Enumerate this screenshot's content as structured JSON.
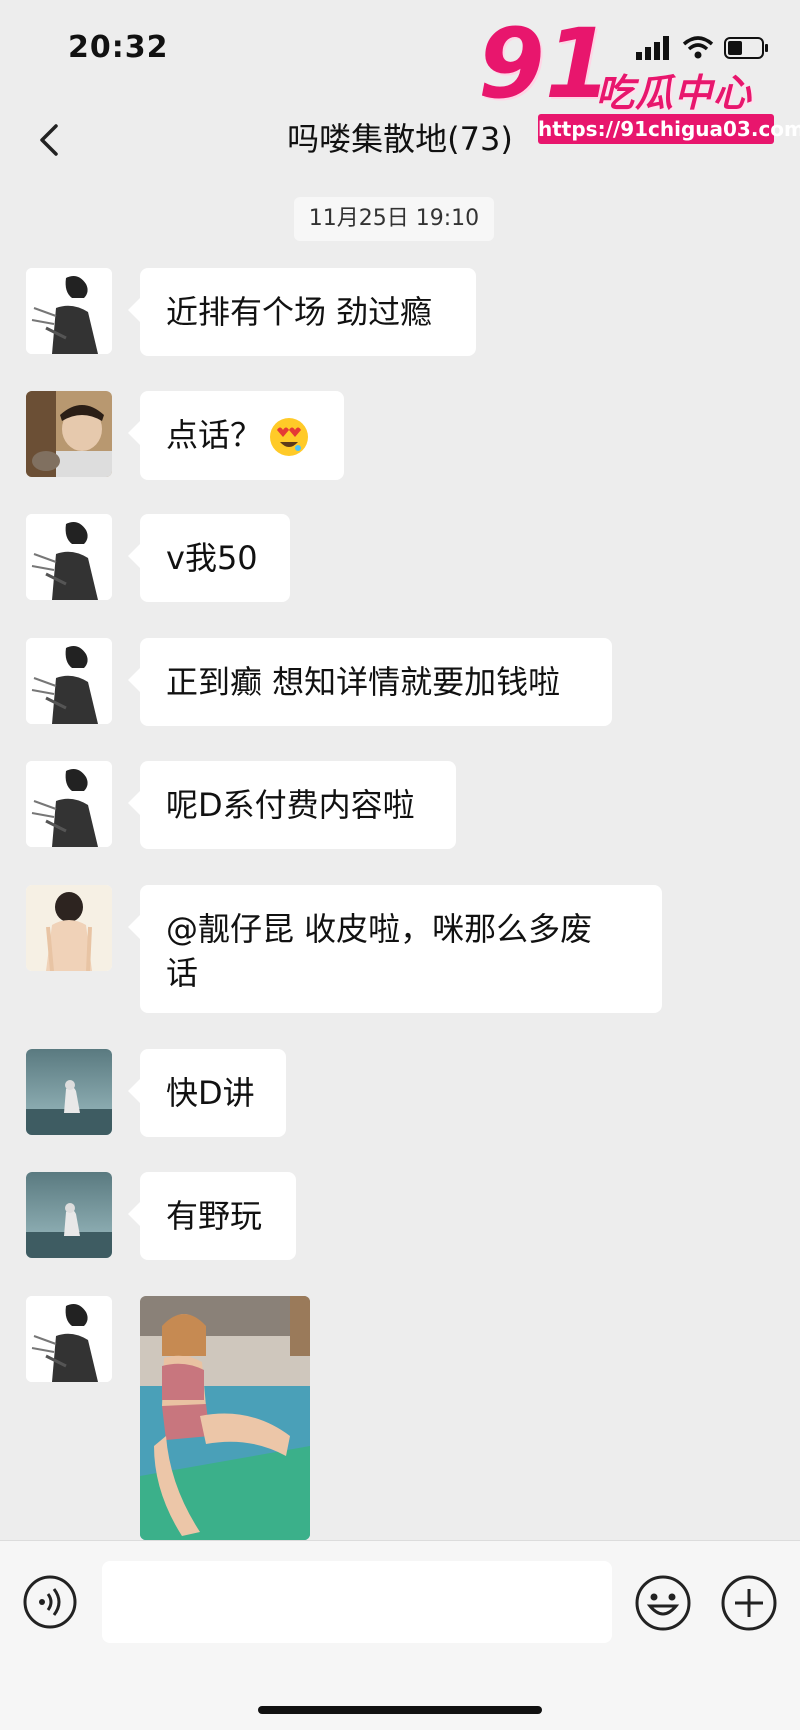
{
  "status_bar": {
    "time": "20:32"
  },
  "watermark": {
    "big_number": "91",
    "brand": "吃瓜中心",
    "url": "https://91chigua03.com"
  },
  "header": {
    "title": "吗喽集散地(73)"
  },
  "chat": {
    "date_label": "11月25日 19:10",
    "messages": [
      {
        "avatar": "manga-sketch-avatar",
        "text": "近排有个场 劲过瘾"
      },
      {
        "avatar": "photo-avatar-person",
        "text": "点话？",
        "emoji": "heart-eyes-emoji"
      },
      {
        "avatar": "manga-sketch-avatar",
        "text": "v我50"
      },
      {
        "avatar": "manga-sketch-avatar",
        "text": "正到癫 想知详情就要加钱啦"
      },
      {
        "avatar": "manga-sketch-avatar",
        "text": "呢D系付费内容啦"
      },
      {
        "avatar": "illustration-avatar-back",
        "text_line1": "@靓仔昆 收皮啦，咪那么多废",
        "text_line2": "话"
      },
      {
        "avatar": "seaside-figure-avatar",
        "text": "快D讲"
      },
      {
        "avatar": "seaside-figure-avatar",
        "text": "有野玩"
      },
      {
        "avatar": "manga-sketch-avatar",
        "image": "shared-photo-thumbnail"
      }
    ]
  },
  "input_bar": {
    "message_value": "",
    "placeholder": ""
  },
  "colors": {
    "background": "#ededed",
    "bubble": "#ffffff",
    "watermark": "#e8166d"
  }
}
